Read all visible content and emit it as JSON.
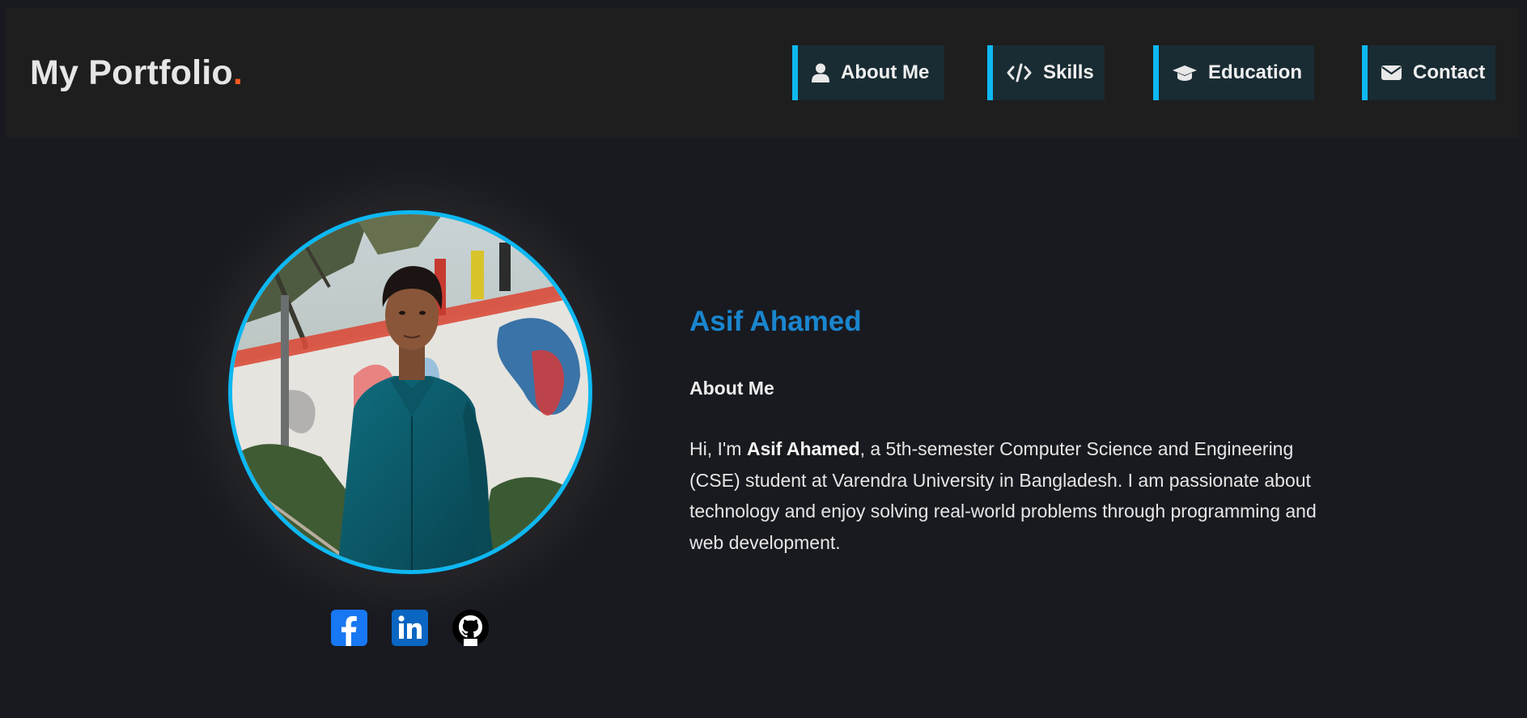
{
  "header": {
    "logo_text": "My Portfolio",
    "logo_dot": ".",
    "logo_dot_color": "#ff5a1f",
    "nav": [
      {
        "label": "About Me",
        "icon": "user-icon"
      },
      {
        "label": "Skills",
        "icon": "code-icon"
      },
      {
        "label": "Education",
        "icon": "graduation-cap-icon"
      },
      {
        "label": "Contact",
        "icon": "envelope-icon"
      }
    ],
    "accent_color": "#0db8f2"
  },
  "profile": {
    "photo_alt": "profile-photo",
    "social": [
      {
        "name": "facebook",
        "icon": "facebook-icon",
        "color": "#1877f2"
      },
      {
        "name": "linkedin",
        "icon": "linkedin-icon",
        "color": "#0a66c2"
      },
      {
        "name": "github",
        "icon": "github-icon",
        "color": "#000000"
      }
    ]
  },
  "intro": {
    "name": "Asif Ahamed",
    "name_color": "#1a86cf",
    "about_title": "About Me",
    "bio_prefix": "Hi, I'm ",
    "bio_name": "Asif Ahamed",
    "bio_rest": ", a 5th-semester Computer Science and Engineering (CSE) student at Varendra University in Bangladesh. I am passionate about technology and enjoy solving real-world problems through programming and web development."
  }
}
